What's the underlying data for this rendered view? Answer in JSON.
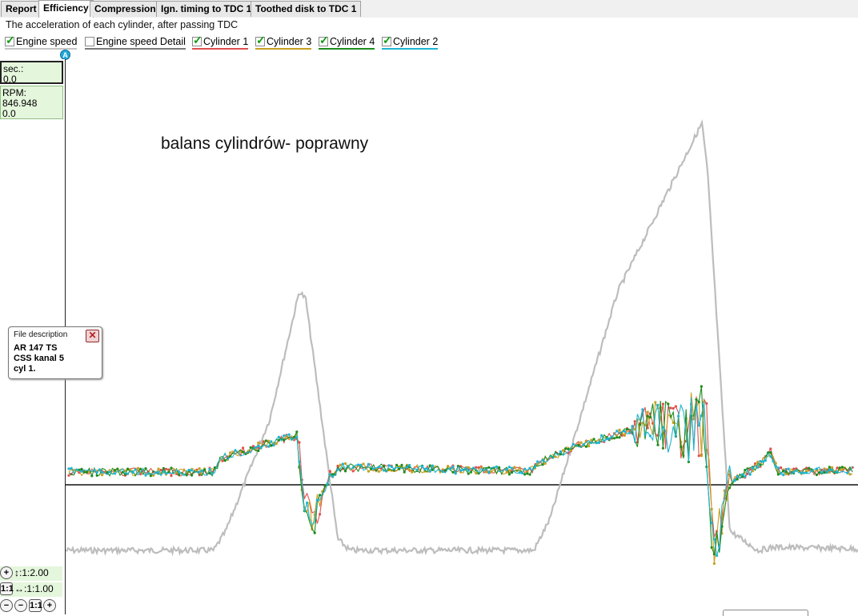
{
  "tabs": [
    {
      "label": "Report",
      "active": false
    },
    {
      "label": "Efficiency",
      "active": true
    },
    {
      "label": "Compression",
      "active": false
    },
    {
      "label": "Ign. timing to TDC 1",
      "active": false
    },
    {
      "label": "Toothed disk to TDC 1",
      "active": false
    }
  ],
  "description": "The acceleration of each cylinder, after passing TDC",
  "series_toggles": [
    {
      "label": "Engine speed",
      "checked": true,
      "color": "#bdbdbd"
    },
    {
      "label": "Engine speed Detail",
      "checked": false,
      "color": "#7a7a7a"
    },
    {
      "label": "Cylinder 1",
      "checked": true,
      "color": "#e05050"
    },
    {
      "label": "Cylinder 3",
      "checked": true,
      "color": "#c8a020"
    },
    {
      "label": "Cylinder 4",
      "checked": true,
      "color": "#1e8c1e"
    },
    {
      "label": "Cylinder 2",
      "checked": true,
      "color": "#1eb4d2"
    }
  ],
  "marker_label": "A",
  "readouts": {
    "time": {
      "label": "sec.:",
      "value": "0.0"
    },
    "rpm": {
      "label": "RPM:",
      "value": "846.948",
      "value2": "0.0"
    }
  },
  "annotation": "balans cylindrów- poprawny",
  "file_description": {
    "title": "File description",
    "lines": [
      "AR  147 TS",
      "CSS kanal 5",
      "cyl 1."
    ],
    "close_icon": "close-x-icon"
  },
  "zoom": {
    "vertical": "↕:1:2.00",
    "horizontal": "↔:1:1.00",
    "ratio_button": "1:1"
  },
  "colors": {
    "engine_speed": "#bdbdbd",
    "cyl1": "#e05050",
    "cyl3": "#c8a020",
    "cyl4": "#1e8c1e",
    "cyl2": "#1eb4d2",
    "readout_bg": "#e4f6dc"
  }
}
